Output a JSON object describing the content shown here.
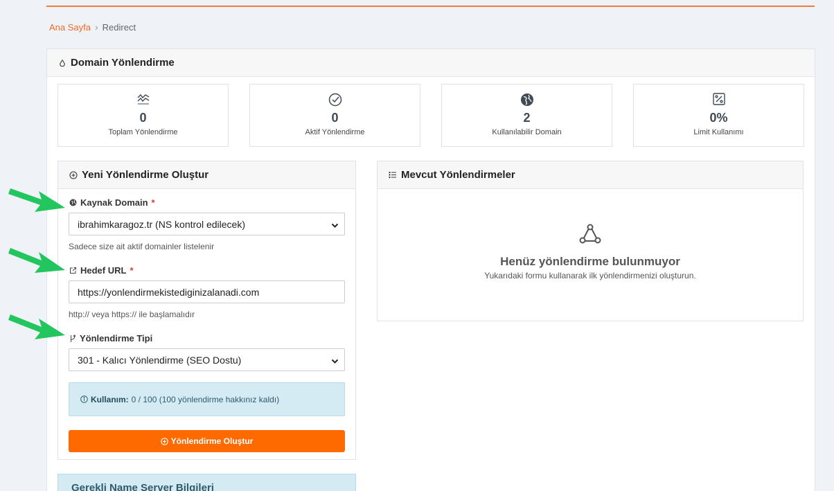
{
  "breadcrumb": {
    "home": "Ana Sayfa",
    "current": "Redirect"
  },
  "page": {
    "title": "Domain Yönlendirme",
    "title_icon": "recycle-icon"
  },
  "stats": [
    {
      "icon": "activity-wave-icon",
      "value": "0",
      "label": "Toplam Yönlendirme"
    },
    {
      "icon": "check-circle-icon",
      "value": "0",
      "label": "Aktif Yönlendirme"
    },
    {
      "icon": "globe-icon",
      "value": "2",
      "label": "Kullanılabilir Domain"
    },
    {
      "icon": "percent-icon",
      "value": "0%",
      "label": "Limit Kullanımı"
    }
  ],
  "form": {
    "title": "Yeni Yönlendirme Oluştur",
    "source": {
      "label": "Kaynak Domain",
      "required": "*",
      "value": "ibrahimkaragoz.tr (NS kontrol edilecek)",
      "help": "Sadece size ait aktif domainler listelenir"
    },
    "target": {
      "label": "Hedef URL",
      "required": "*",
      "value": "https://yonlendirmekistediginizalanadi.com",
      "help": "http:// veya https:// ile başlamalıdır"
    },
    "type": {
      "label": "Yönlendirme Tipi",
      "value": "301 - Kalıcı Yönlendirme (SEO Dostu)"
    },
    "usage": {
      "label": "Kullanım:",
      "text": "0 / 100 (100 yönlendirme hakkınız kaldı)"
    },
    "submit_label": "Yönlendirme Oluştur"
  },
  "list": {
    "title": "Mevcut Yönlendirmeler",
    "empty_title": "Henüz yönlendirme bulunmuyor",
    "empty_sub": "Yukarıdaki formu kullanarak ilk yönlendirmenizi oluşturun."
  },
  "ns": {
    "title": "Gerekli Name Server Bilgileri"
  },
  "colors": {
    "accent": "#ff6a00",
    "arrow": "#22c55e",
    "info_bg": "#d5ebf4"
  }
}
